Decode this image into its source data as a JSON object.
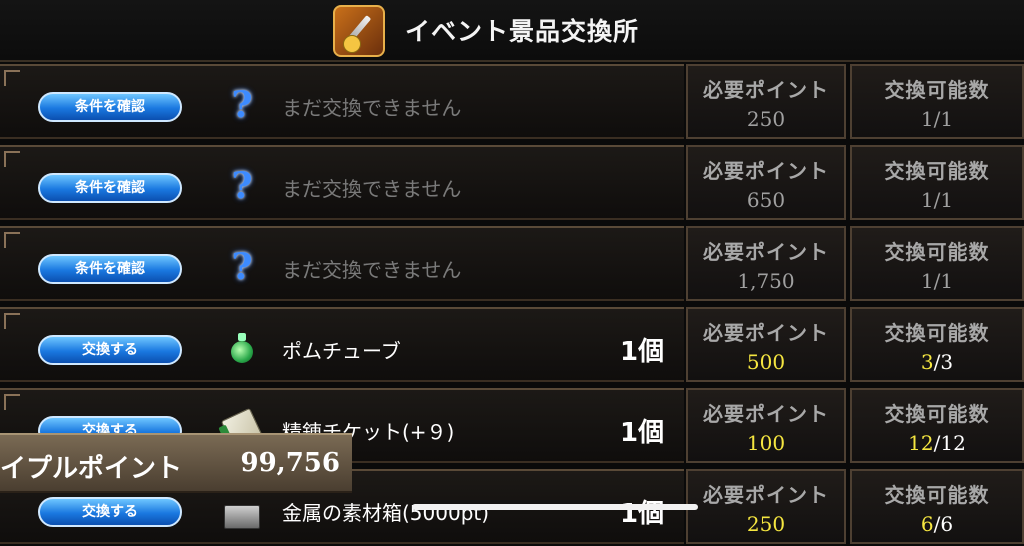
{
  "header": {
    "title": "イベント景品交換所",
    "icon": "event-shop-icon"
  },
  "columns": {
    "required_label": "必要ポイント",
    "count_label": "交換可能数"
  },
  "rows": [
    {
      "button": "条件を確認",
      "icon": "question-icon",
      "name": "まだ交換できません",
      "qty": "",
      "points": "250",
      "avail_done": "",
      "avail_text": "1/1",
      "avail_max": "",
      "locked": true
    },
    {
      "button": "条件を確認",
      "icon": "question-icon",
      "name": "まだ交換できません",
      "qty": "",
      "points": "650",
      "avail_done": "",
      "avail_text": "1/1",
      "avail_max": "",
      "locked": true
    },
    {
      "button": "条件を確認",
      "icon": "question-icon",
      "name": "まだ交換できません",
      "qty": "",
      "points": "1,750",
      "avail_done": "",
      "avail_text": "1/1",
      "avail_max": "",
      "locked": true
    },
    {
      "button": "交換する",
      "icon": "potion-icon",
      "name": "ポムチューブ",
      "qty": "1個",
      "points": "500",
      "avail_done": "3",
      "avail_text": "",
      "avail_max": "/3",
      "locked": false
    },
    {
      "button": "交換する",
      "icon": "ticket-icon",
      "name": "精錬チケット(+９)",
      "qty": "1個",
      "points": "100",
      "avail_done": "12",
      "avail_text": "",
      "avail_max": "/12",
      "locked": false
    },
    {
      "button": "交換する",
      "icon": "material-box-icon",
      "name": "金属の素材箱(5000pt)",
      "qty": "1個",
      "points": "250",
      "avail_done": "6",
      "avail_text": "",
      "avail_max": "/6",
      "locked": false
    }
  ],
  "points_bar": {
    "label": "イプルポイント",
    "value": "99,756"
  }
}
